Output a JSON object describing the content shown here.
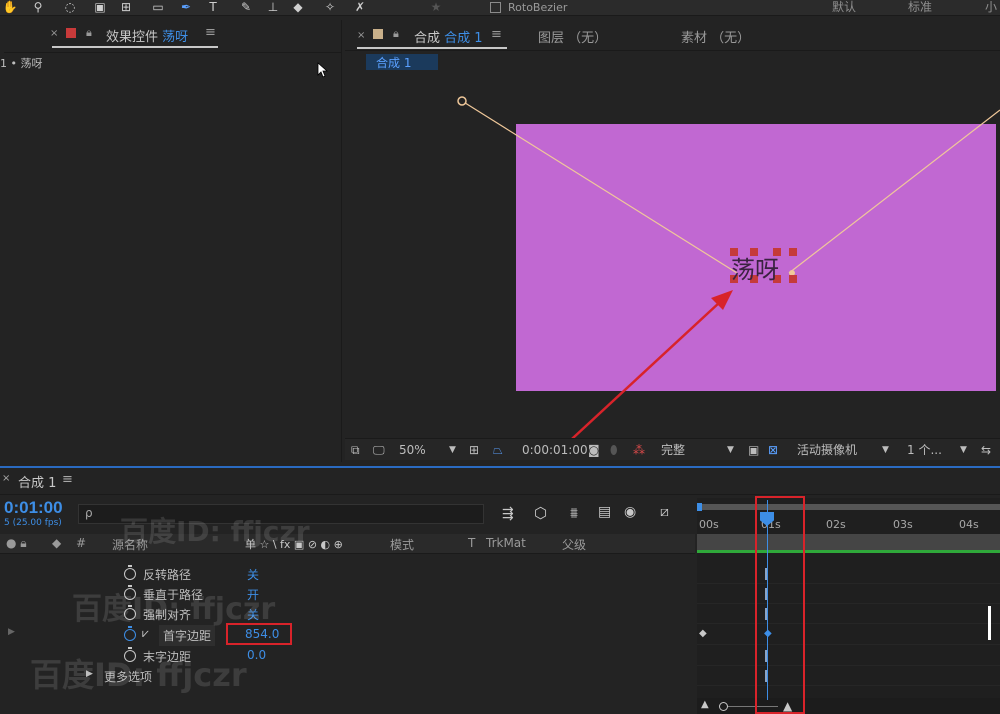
{
  "toolbar": {
    "roto_label": "RotoBezier",
    "workspaces": [
      "默认",
      "标准",
      "小"
    ]
  },
  "effects_panel": {
    "close": "×",
    "tab_prefix": "效果控件",
    "tab_layer": "荡呀",
    "menu": "≡",
    "layer_path": "1 • 荡呀"
  },
  "comp_panel": {
    "close": "×",
    "tab_prefix": "合成",
    "tab_comp": "合成 1",
    "menu": "≡",
    "layer_tab": "图层 （无）",
    "footage_tab": "素材 （无）",
    "comp_chip": "合成 1",
    "layer_text": "荡呀",
    "canvas_color": "#c168d2"
  },
  "viewer_bar": {
    "zoom": "50%",
    "timecode": "0:00:01:00",
    "resolution": "完整",
    "camera": "活动摄像机",
    "views": "1 个..."
  },
  "timeline": {
    "close": "×",
    "tab": "合成 1",
    "menu": "≡",
    "timecode": "0:01:00",
    "fps": "5 (25.00 fps)",
    "search_placeholder": "ρ",
    "headers": {
      "num": "#",
      "source": "源名称",
      "switches": "单 ☆ \\ fx ▣ ⊘ ◐ ⊕",
      "mode": "模式",
      "t": "T",
      "trkmat": "TrkMat",
      "parent": "父级"
    },
    "properties": [
      {
        "name": "反转路径",
        "value": "关",
        "active": false
      },
      {
        "name": "垂直于路径",
        "value": "开",
        "active": false
      },
      {
        "name": "强制对齐",
        "value": "关",
        "active": false
      },
      {
        "name": "首字边距",
        "value": "854.0",
        "active": true
      },
      {
        "name": "末字边距",
        "value": "0.0",
        "active": false
      }
    ],
    "more_options": "更多选项",
    "ruler": [
      "00s",
      "01s",
      "02s",
      "03s",
      "04s"
    ]
  },
  "watermarks": [
    "百度ID: ffjczr",
    "百度ID: ffjczr",
    "百度ID: ffjczr"
  ],
  "annotation_color": "#d8232a"
}
